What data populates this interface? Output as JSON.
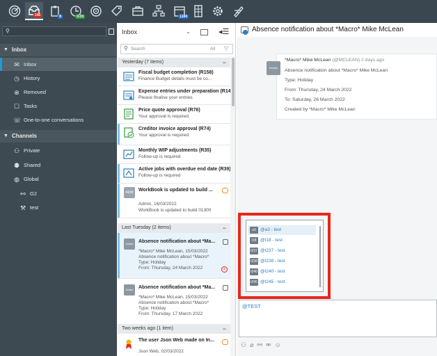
{
  "toolbar": {
    "items": [
      {
        "icon": "radar-icon"
      },
      {
        "icon": "inbox-tray-icon",
        "badge": "145",
        "badge_color": "#e8261a"
      },
      {
        "icon": "clipboard-icon",
        "badge": "8",
        "badge_color": "#1e6fd9"
      },
      {
        "icon": "clock-icon",
        "badge": "0.03",
        "badge_color": "#2e9a3c"
      },
      {
        "icon": "target-icon"
      },
      {
        "icon": "tags-icon"
      },
      {
        "icon": "briefcase-icon"
      },
      {
        "icon": "org-chart-icon"
      },
      {
        "icon": "calendar-icon",
        "badge": "1184",
        "badge_color": "#1e6fd9"
      },
      {
        "icon": "spreadsheet-icon"
      },
      {
        "icon": "gear-icon"
      },
      {
        "icon": "pen-tools-icon"
      }
    ]
  },
  "sidebar": {
    "inbox_header": "Inbox",
    "inbox_items": [
      {
        "label": "Inbox",
        "icon": "mail-icon"
      },
      {
        "label": "History",
        "icon": "history-icon"
      },
      {
        "label": "Removed",
        "icon": "removed-icon"
      },
      {
        "label": "Tasks",
        "icon": "tasks-icon"
      },
      {
        "label": "One-to-one conversations",
        "icon": "conversation-icon"
      }
    ],
    "channels_header": "Channels",
    "channel_items": [
      {
        "label": "Private",
        "icon": "private-icon"
      },
      {
        "label": "Shared",
        "icon": "shared-icon"
      },
      {
        "label": "Global",
        "icon": "globe-icon"
      },
      {
        "label": "G2",
        "icon": "link-icon"
      },
      {
        "label": "test",
        "icon": "wrench-icon"
      }
    ]
  },
  "list": {
    "title": "Inbox",
    "search_placeholder": "Search",
    "filter_label": "All",
    "groups": [
      {
        "label": "Yesterday (7 items)"
      },
      {
        "label": "Last Tuesday (2 items)"
      },
      {
        "label": "Two weeks ago (1 item)"
      }
    ],
    "entries": [
      {
        "title": "Fiscal budget completion (R158)",
        "line1": "Finance Budget details must be co...",
        "line2": ""
      },
      {
        "title": "Expense entries under preparation (R14...",
        "line1": "Please finalise your entries",
        "line2": ""
      },
      {
        "title": "Price quote approval (R76)",
        "line1": "Your approval is required.",
        "line2": ""
      },
      {
        "title": "Creditor invoice approval (R74)",
        "line1": "Your approval is required.",
        "line2": ""
      },
      {
        "title": "Monthly WIP adjustments (R35)",
        "line1": "Follow-up is required",
        "line2": ""
      },
      {
        "title": "Active jobs with overdue end date (R39)",
        "line1": "Follow-up is required",
        "line2": ""
      },
      {
        "title": "WorkBook is updated to build ...",
        "line1": "Admin, 16/03/2022",
        "line2": "WorkBook is updated to build 01300"
      },
      {
        "title": "Absence notification about *Ma...",
        "line1": "*Macro* Mike McLean, 15/03/2022",
        "line2": "Absence notification about *Macro*",
        "line3": "Type: Holiday",
        "line4": "From: Thursday, 24 March 2022"
      },
      {
        "title": "Absence notification about *Ma...",
        "line1": "*Macro* Mike McLean, 15/03/2022",
        "line2": "Absence notification about *Macro*",
        "line3": "Type: Holiday",
        "line4": "From: Thursday, 17 March 2022"
      },
      {
        "title": "The user Json Web made on In...",
        "line1": "Json Web, 02/03/2022",
        "line2": ""
      }
    ],
    "admin_avatar": "ADM",
    "macro_avatar": "Nokian"
  },
  "detail": {
    "title": "Absence notification about *Macro* Mike McLean",
    "card": {
      "avatar": "Nokian",
      "sender": "*Macro* Mike McLean",
      "handle": "(@MCLEAN) 2 days ago",
      "line1": "Absence notification about *Macro* Mike McLean",
      "line2": "Type: Holiday",
      "line3": "From: Thursday, 24 March 2022",
      "line4": "To: Saturday, 26 March 2022",
      "line5": "Created by *Macro* Mike McLean"
    },
    "mentions": [
      {
        "tag": "a3",
        "label": "@a3 - test"
      },
      {
        "tag": "t18",
        "label": "@t18 - test"
      },
      {
        "tag": "t237",
        "label": "@t237 - test"
      },
      {
        "tag": "t238",
        "label": "@t238 - test"
      },
      {
        "tag": "t240",
        "label": "@t240 - test"
      },
      {
        "tag": "t245",
        "label": "@t245 - test"
      }
    ],
    "compose_value": "@TEST",
    "accent": "#e8261a"
  }
}
